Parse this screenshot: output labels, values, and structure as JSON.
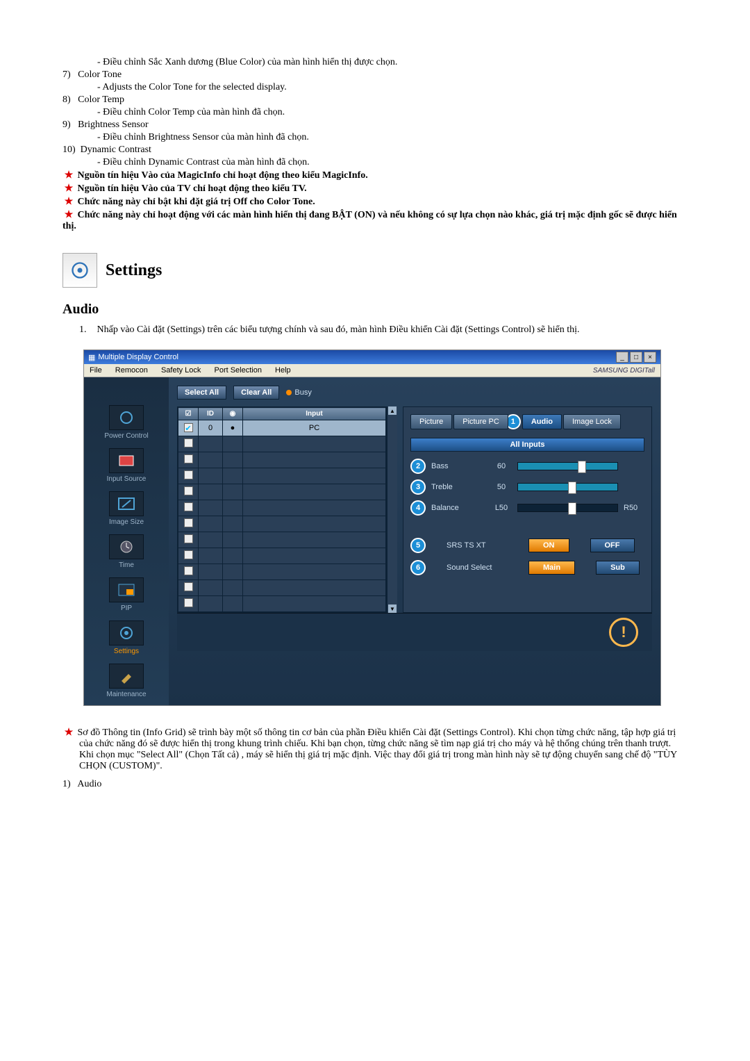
{
  "items": {
    "blueSub": "- Điều chỉnh Sắc Xanh dương (Blue Color) của màn hình hiển thị được chọn.",
    "i7": "Color Tone",
    "i7sub": "- Adjusts the Color Tone for the selected display.",
    "i8": "Color Temp",
    "i8sub": "- Điều chỉnh Color Temp của màn hình đã chọn.",
    "i9": "Brightness Sensor",
    "i9sub": "- Điều chỉnh Brightness Sensor của màn hình đã chọn.",
    "i10": "Dynamic Contrast",
    "i10sub": "- Điều chỉnh Dynamic Contrast của màn hình đã chọn.",
    "n7": "7)",
    "n8": "8)",
    "n9": "9)",
    "n10": "10)"
  },
  "stars": {
    "s1": "Nguồn tín hiệu Vào của MagicInfo chỉ hoạt động theo kiểu MagicInfo.",
    "s2": "Nguồn tín hiệu Vào của TV chỉ hoạt động theo kiểu TV.",
    "s3": "Chức năng này chỉ bật khi đặt giá trị Off cho Color Tone.",
    "s4": "Chức năng này chỉ hoạt động với các màn hình hiển thị đang BẬT (ON) và nếu không có sự lựa chọn nào khác, giá trị mặc định gốc sẽ được hiển thị."
  },
  "settingsTitle": "Settings",
  "audio": {
    "title": "Audio",
    "step1num": "1.",
    "step1": "Nhấp vào Cài đặt (Settings) trên các biểu tượng chính và sau đó, màn hình Điều khiển Cài đặt (Settings Control) sẽ hiển thị."
  },
  "app": {
    "title": "Multiple Display Control",
    "menus": {
      "file": "File",
      "remocon": "Remocon",
      "safety": "Safety Lock",
      "port": "Port Selection",
      "help": "Help"
    },
    "brand": "SAMSUNG DIGITall",
    "buttons": {
      "selectAll": "Select All",
      "clearAll": "Clear All",
      "busy": "Busy"
    },
    "sidebar": {
      "power": "Power Control",
      "input": "Input Source",
      "image": "Image Size",
      "time": "Time",
      "pip": "PIP",
      "settings": "Settings",
      "maint": "Maintenance"
    },
    "grid": {
      "hdrChk": "☑",
      "hdrId": "ID",
      "hdrLamp": "◉",
      "hdrInput": "Input",
      "row0": {
        "id": "0",
        "input": "PC"
      }
    },
    "tabs": {
      "picture": "Picture",
      "picturePc": "Picture PC",
      "audio": "Audio",
      "imageLock": "Image Lock"
    },
    "allInputs": "All Inputs",
    "sliders": {
      "bass": {
        "label": "Bass",
        "value": "60"
      },
      "treble": {
        "label": "Treble",
        "value": "50"
      },
      "balance": {
        "label": "Balance",
        "left": "L50",
        "right": "R50"
      }
    },
    "srs": {
      "label": "SRS TS XT",
      "on": "ON",
      "off": "OFF"
    },
    "sound": {
      "label": "Sound Select",
      "main": "Main",
      "sub": "Sub"
    }
  },
  "footnotes": {
    "f1": "Sơ đồ Thông tin (Info Grid) sẽ trình bày một số thông tin cơ bản của phần Điều khiển Cài đặt (Settings Control). Khi chọn từng chức năng, tập hợp giá trị của chức năng đó sẽ được hiển thị trong khung trình chiếu. Khi bạn chọn, từng chức năng sẽ tìm nạp giá trị cho máy và hệ thống chúng trên thanh trượt. Khi chọn mục \"Select All\" (Chọn Tất cả) , máy sẽ hiển thị giá trị mặc định. Việc thay đổi giá trị trong màn hình này sẽ tự động chuyển sang chế độ \"TÙY CHỌN (CUSTOM)\".",
    "f2num": "1)",
    "f2": "Audio"
  }
}
